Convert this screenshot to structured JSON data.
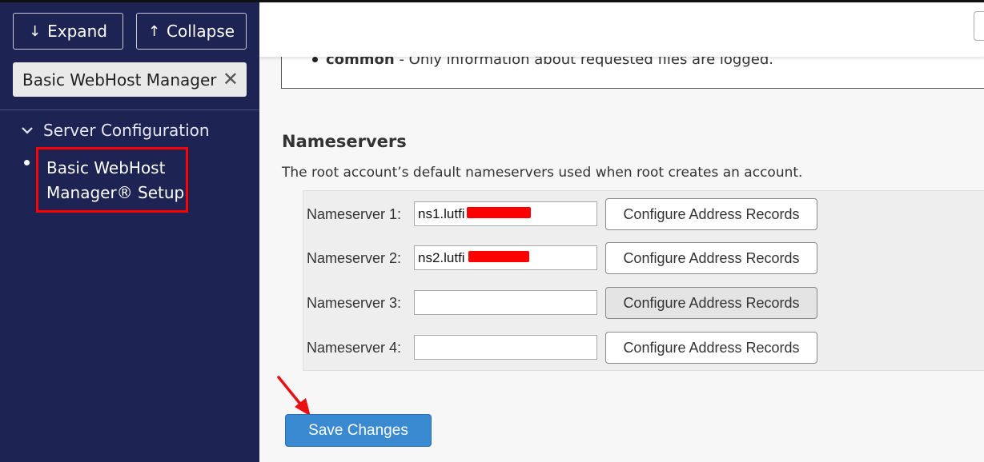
{
  "sidebar": {
    "expand_label": "Expand",
    "collapse_label": "Collapse",
    "search_value": "Basic WebHost Manager",
    "section_label": "Server Configuration",
    "item_label_line1": "Basic WebHost",
    "item_label_line2": "Manager® Setup"
  },
  "main": {
    "previous_item_bold": "common",
    "previous_item_text": " - Only information about requested files are logged.",
    "nameservers_title": "Nameservers",
    "nameservers_desc": "The root account’s default nameservers used when root creates an account.",
    "rows": [
      {
        "label": "Nameserver 1:",
        "value": "ns1.lutfi",
        "button": "Configure Address Records"
      },
      {
        "label": "Nameserver 2:",
        "value": "ns2.lutfi",
        "button": "Configure Address Records"
      },
      {
        "label": "Nameserver 3:",
        "value": "",
        "button": "Configure Address Records"
      },
      {
        "label": "Nameserver 4:",
        "value": "",
        "button": "Configure Address Records"
      }
    ],
    "save_label": "Save Changes"
  },
  "colors": {
    "sidebar_bg": "#1d2453",
    "highlight": "#ff0000",
    "save_button": "#3a8ad2"
  },
  "icons": [
    "arrow-down-icon",
    "arrow-up-icon",
    "close-icon",
    "chevron-down-icon",
    "annotation-arrow-icon"
  ]
}
